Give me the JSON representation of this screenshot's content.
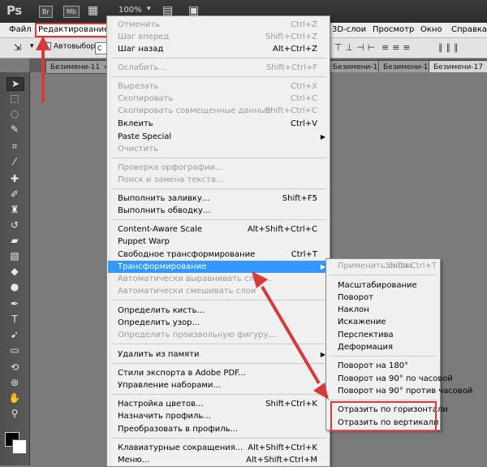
{
  "appbar": {
    "logo": "Ps",
    "bridge_label": "Br",
    "minibridge_label": "Mb",
    "zoom": "100%"
  },
  "menubar": {
    "items": [
      "Файл",
      "Редактирование",
      "3D-слои",
      "Просмотр",
      "Окно",
      "Справка"
    ]
  },
  "options": {
    "autoselect_label": "Автовыбор:",
    "autoselect_value": "С"
  },
  "tabs": [
    {
      "label": "Безимени-11"
    },
    {
      "label": "Безимени-15"
    },
    {
      "label": "Безимени-16"
    },
    {
      "label": "Безимени-17"
    }
  ],
  "edit_menu": {
    "items": [
      {
        "label": "Отменить",
        "shortcut": "Ctrl+Z",
        "disabled": true
      },
      {
        "label": "Шаг вперед",
        "shortcut": "Shift+Ctrl+Z",
        "disabled": true
      },
      {
        "label": "Шаг назад",
        "shortcut": "Alt+Ctrl+Z",
        "disabled": false
      },
      {
        "label": "Ослабить...",
        "shortcut": "Shift+Ctrl+F",
        "disabled": true
      },
      {
        "label": "Вырезать",
        "shortcut": "Ctrl+X",
        "disabled": true
      },
      {
        "label": "Скопировать",
        "shortcut": "Ctrl+C",
        "disabled": true
      },
      {
        "label": "Скопировать совмещенные данные",
        "shortcut": "Shift+Ctrl+C",
        "disabled": true
      },
      {
        "label": "Вклеить",
        "shortcut": "Ctrl+V",
        "disabled": false
      },
      {
        "label": "Paste Special",
        "shortcut": "",
        "disabled": false
      },
      {
        "label": "Очистить",
        "shortcut": "",
        "disabled": true
      },
      {
        "label": "Проверка орфографии...",
        "shortcut": "",
        "disabled": true
      },
      {
        "label": "Поиск и замена текста...",
        "shortcut": "",
        "disabled": true
      },
      {
        "label": "Выполнить заливку...",
        "shortcut": "Shift+F5",
        "disabled": false
      },
      {
        "label": "Выполнить обводку...",
        "shortcut": "",
        "disabled": false
      },
      {
        "label": "Content-Aware Scale",
        "shortcut": "Alt+Shift+Ctrl+C",
        "disabled": false
      },
      {
        "label": "Puppet Warp",
        "shortcut": "",
        "disabled": false
      },
      {
        "label": "Свободное трансформирование",
        "shortcut": "Ctrl+T",
        "disabled": false
      },
      {
        "label": "Трансформирование",
        "shortcut": "",
        "disabled": false
      },
      {
        "label": "Автоматически выравнивать слои...",
        "shortcut": "",
        "disabled": true
      },
      {
        "label": "Автоматически смешивать слои",
        "shortcut": "",
        "disabled": true
      },
      {
        "label": "Определить кисть...",
        "shortcut": "",
        "disabled": false
      },
      {
        "label": "Определить узор...",
        "shortcut": "",
        "disabled": false
      },
      {
        "label": "Определить произвольную фигуру...",
        "shortcut": "",
        "disabled": true
      },
      {
        "label": "Удалить из памяти",
        "shortcut": "",
        "disabled": false
      },
      {
        "label": "Стили экспорта в Adobe PDF...",
        "shortcut": "",
        "disabled": false
      },
      {
        "label": "Управление наборами...",
        "shortcut": "",
        "disabled": false
      },
      {
        "label": "Настройка цветов...",
        "shortcut": "Shift+Ctrl+K",
        "disabled": false
      },
      {
        "label": "Назначить профиль...",
        "shortcut": "",
        "disabled": false
      },
      {
        "label": "Преобразовать в профиль...",
        "shortcut": "",
        "disabled": false
      },
      {
        "label": "Клавиатурные сокращения...",
        "shortcut": "Alt+Shift+Ctrl+K",
        "disabled": false
      },
      {
        "label": "Меню...",
        "shortcut": "Alt+Shift+Ctrl+M",
        "disabled": false
      }
    ]
  },
  "transform_submenu": {
    "items": [
      {
        "label": "Применить снова",
        "shortcut": "Shift+Ctrl+T",
        "disabled": true
      },
      {
        "label": "Масштабирование",
        "shortcut": "",
        "disabled": false
      },
      {
        "label": "Поворот",
        "shortcut": "",
        "disabled": false
      },
      {
        "label": "Наклон",
        "shortcut": "",
        "disabled": false
      },
      {
        "label": "Искажение",
        "shortcut": "",
        "disabled": false
      },
      {
        "label": "Перспектива",
        "shortcut": "",
        "disabled": false
      },
      {
        "label": "Деформация",
        "shortcut": "",
        "disabled": false
      },
      {
        "label": "Поворот на 180°",
        "shortcut": "",
        "disabled": false
      },
      {
        "label": "Поворот на 90° по часовой",
        "shortcut": "",
        "disabled": false
      },
      {
        "label": "Поворот на 90° против часовой",
        "shortcut": "",
        "disabled": false
      },
      {
        "label": "Отразить по горизонтали",
        "shortcut": "",
        "disabled": false
      },
      {
        "label": "Отразить по вертикали",
        "shortcut": "",
        "disabled": false
      }
    ]
  },
  "colors": {
    "highlight": "#3399ff",
    "annotation_red": "#d63b3b"
  }
}
